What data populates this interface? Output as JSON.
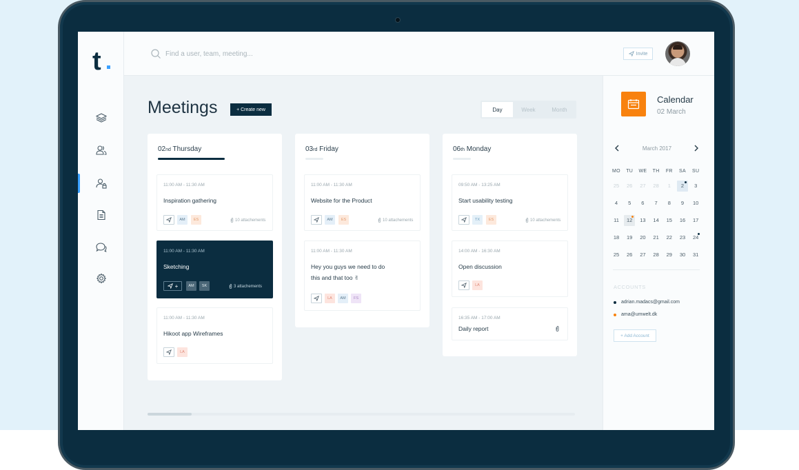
{
  "app": {
    "logo": "t."
  },
  "header": {
    "search_placeholder": "Find a user, team, meeting...",
    "invite_label": "Invite"
  },
  "main": {
    "title": "Meetings",
    "create_label": "+ Create new",
    "views": [
      "Day",
      "Week",
      "Month"
    ],
    "active_view": "Day",
    "columns": [
      {
        "day_num": "02",
        "day_suffix": "nd",
        "day_name": "Thursday",
        "active": true,
        "meetings": [
          {
            "time": "11:00 AM - 11:30 AM",
            "title": "Inspiration gathering",
            "chips": [
              "AM",
              "ES"
            ],
            "attachments": "10 attachements"
          },
          {
            "time": "11:00 AM - 11:30 AM",
            "title": "Sketching",
            "chips": [
              "AM",
              "SK"
            ],
            "attachments": "3 attachements",
            "highlighted": true
          },
          {
            "time": "11:00 AM - 11:30 AM",
            "title": "Hikoot app Wireframes",
            "chips": [
              "LA"
            ]
          }
        ]
      },
      {
        "day_num": "03",
        "day_suffix": "rd",
        "day_name": "Friday",
        "active": false,
        "meetings": [
          {
            "time": "11:00 AM - 11:30 AM",
            "title": "Website for the Product",
            "chips": [
              "AM",
              "ES"
            ],
            "attachments": "10 attachements"
          },
          {
            "time": "11:00 AM - 11:30 AM",
            "title": "Hey you guys we need to do this and that too ✌",
            "chips": [
              "LA",
              "AM",
              "FS"
            ]
          }
        ]
      },
      {
        "day_num": "06",
        "day_suffix": "th",
        "day_name": "Monday",
        "active": false,
        "meetings": [
          {
            "time": "09:50 AM - 13:25 AM",
            "title": "Start usability testing",
            "chips": [
              "TX",
              "ES"
            ],
            "attachments": "10 attachements"
          },
          {
            "time": "14:00 AM - 16:30 AM",
            "title": "Open discussion",
            "chips": [
              "LA"
            ]
          },
          {
            "time": "16:35 AM - 17:00 AM",
            "title": "Daily report"
          }
        ]
      }
    ]
  },
  "calendar": {
    "title": "Calendar",
    "date": "02 March",
    "month": "March 2017",
    "weekdays": [
      "MO",
      "TU",
      "WE",
      "TH",
      "FR",
      "SA",
      "SU"
    ],
    "weeks": [
      [
        "25",
        "26",
        "27",
        "28",
        "1",
        "2",
        "3"
      ],
      [
        "4",
        "5",
        "6",
        "7",
        "8",
        "9",
        "10"
      ],
      [
        "11",
        "12",
        "13",
        "14",
        "15",
        "16",
        "17"
      ],
      [
        "18",
        "19",
        "20",
        "21",
        "22",
        "23",
        "24"
      ],
      [
        "25",
        "26",
        "27",
        "28",
        "29",
        "30",
        "31"
      ]
    ],
    "selected_day": "2",
    "accounts_label": "ACCOUNTS",
    "accounts": [
      {
        "email": "adrian.madacs@gmail.com",
        "color": "#0b2d40"
      },
      {
        "email": "ama@umwelt.dk",
        "color": "#f8820e"
      }
    ],
    "add_account_label": "+ Add Account"
  },
  "colors": {
    "brand_dark": "#0b2d40",
    "accent_orange": "#f8820e",
    "accent_blue": "#3aa0ff"
  }
}
